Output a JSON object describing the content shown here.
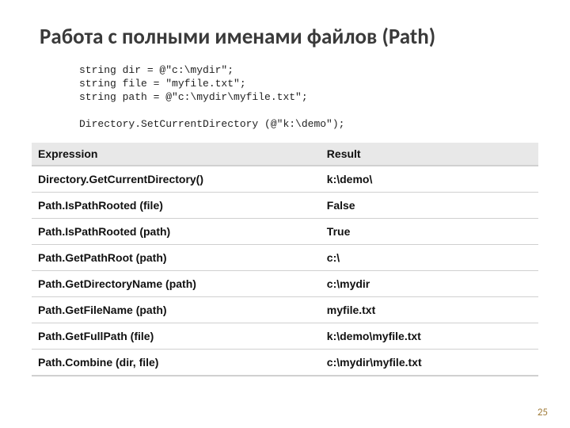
{
  "title": "Работа с полными именами файлов (Path)",
  "code": {
    "l1": "string dir = @\"c:\\mydir\";",
    "l2": "string file = \"myfile.txt\";",
    "l3": "string path = @\"c:\\mydir\\myfile.txt\";",
    "l4": "",
    "l5": "Directory.SetCurrentDirectory (@\"k:\\demo\");"
  },
  "table": {
    "headers": {
      "expr": "Expression",
      "result": "Result"
    },
    "rows": [
      {
        "expr": "Directory.GetCurrentDirectory()",
        "result": "k:\\demo\\"
      },
      {
        "expr": "Path.IsPathRooted (file)",
        "result": "False"
      },
      {
        "expr": "Path.IsPathRooted (path)",
        "result": "True"
      },
      {
        "expr": "Path.GetPathRoot (path)",
        "result": "c:\\"
      },
      {
        "expr": "Path.GetDirectoryName (path)",
        "result": "c:\\mydir"
      },
      {
        "expr": "Path.GetFileName (path)",
        "result": "myfile.txt"
      },
      {
        "expr": "Path.GetFullPath (file)",
        "result": "k:\\demo\\myfile.txt"
      },
      {
        "expr": "Path.Combine (dir, file)",
        "result": "c:\\mydir\\myfile.txt"
      }
    ]
  },
  "page_number": "25"
}
